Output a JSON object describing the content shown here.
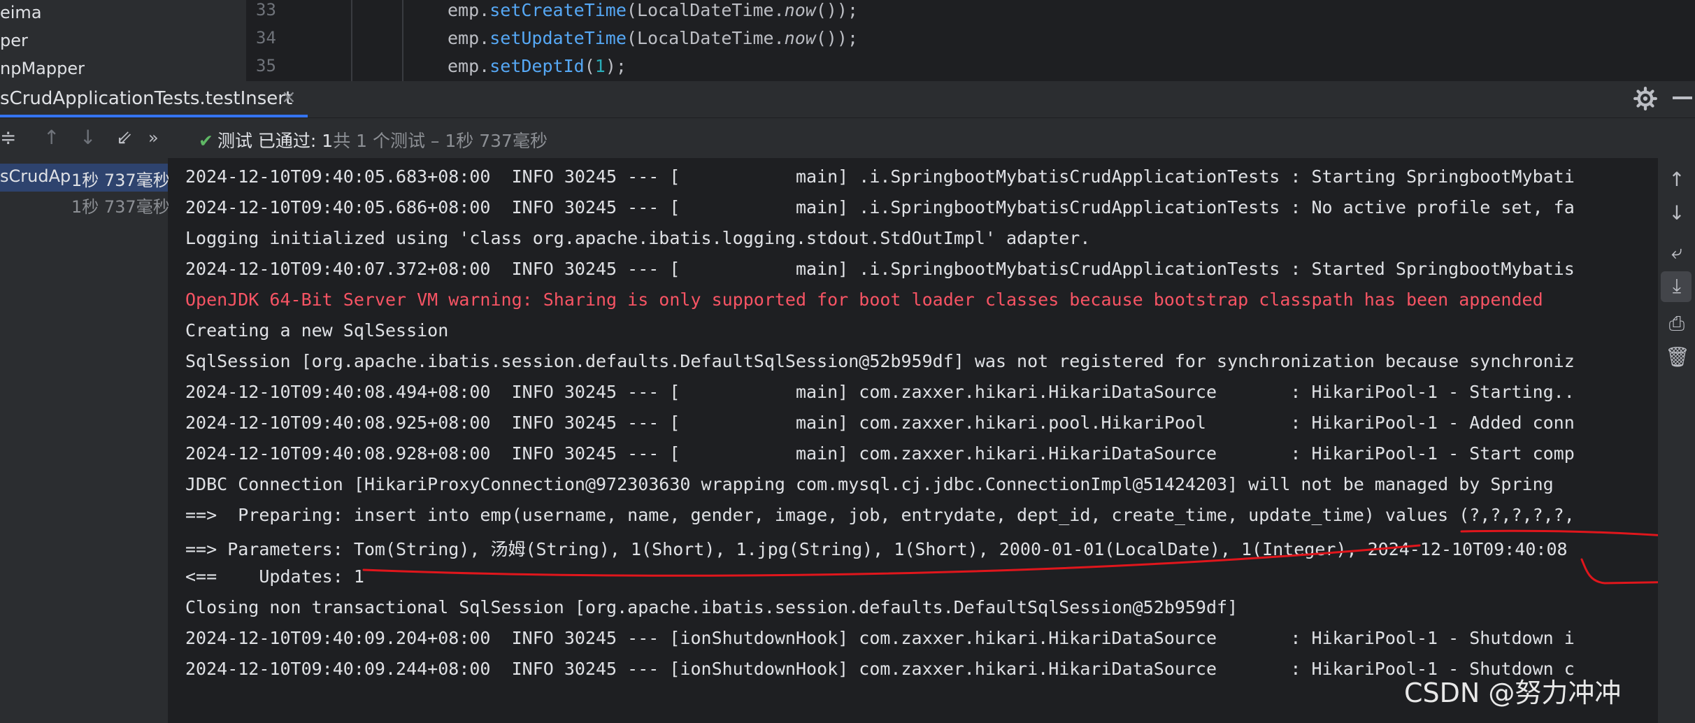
{
  "project": {
    "items": [
      "eima",
      "per",
      "npMapper"
    ]
  },
  "editor": {
    "line_numbers": [
      "33",
      "34",
      "35"
    ],
    "lines": [
      {
        "pre": "emp.",
        "method": "setCreateTime",
        "mid": "(LocalDateTime.",
        "call": "now",
        "post": "());"
      },
      {
        "pre": "emp.",
        "method": "setUpdateTime",
        "mid": "(LocalDateTime.",
        "call": "now",
        "post": "());"
      },
      {
        "pre": "emp.",
        "method": "setDeptId",
        "mid": "(",
        "call": "1",
        "post": ");"
      }
    ]
  },
  "run_tab": {
    "label": "sCrudApplicationTests.testInsert",
    "close": "×"
  },
  "toolbar": {
    "status_main": "测试 已通过: 1",
    "status_detail": "共 1 个测试 – 1秒 737毫秒"
  },
  "tree": {
    "root_name": "sCrudAp",
    "root_time": "1秒 737毫秒",
    "child_time": "1秒 737毫秒"
  },
  "console": {
    "lines": [
      {
        "text": "2024-12-10T09:40:05.683+08:00  INFO 30245 --- [           main] .i.SpringbootMybatisCrudApplicationTests : Starting SpringbootMybati",
        "warn": false
      },
      {
        "text": "2024-12-10T09:40:05.686+08:00  INFO 30245 --- [           main] .i.SpringbootMybatisCrudApplicationTests : No active profile set, fa",
        "warn": false
      },
      {
        "text": "Logging initialized using 'class org.apache.ibatis.logging.stdout.StdOutImpl' adapter.",
        "warn": false
      },
      {
        "text": "2024-12-10T09:40:07.372+08:00  INFO 30245 --- [           main] .i.SpringbootMybatisCrudApplicationTests : Started SpringbootMybatis",
        "warn": false
      },
      {
        "text": "OpenJDK 64-Bit Server VM warning: Sharing is only supported for boot loader classes because bootstrap classpath has been appended",
        "warn": true
      },
      {
        "text": "Creating a new SqlSession",
        "warn": false
      },
      {
        "text": "SqlSession [org.apache.ibatis.session.defaults.DefaultSqlSession@52b959df] was not registered for synchronization because synchroniz",
        "warn": false
      },
      {
        "text": "2024-12-10T09:40:08.494+08:00  INFO 30245 --- [           main] com.zaxxer.hikari.HikariDataSource       : HikariPool-1 - Starting..",
        "warn": false
      },
      {
        "text": "2024-12-10T09:40:08.925+08:00  INFO 30245 --- [           main] com.zaxxer.hikari.pool.HikariPool        : HikariPool-1 - Added conn",
        "warn": false
      },
      {
        "text": "2024-12-10T09:40:08.928+08:00  INFO 30245 --- [           main] com.zaxxer.hikari.HikariDataSource       : HikariPool-1 - Start comp",
        "warn": false
      },
      {
        "text": "JDBC Connection [HikariProxyConnection@972303630 wrapping com.mysql.cj.jdbc.ConnectionImpl@51424203] will not be managed by Spring",
        "warn": false
      },
      {
        "text": "==>  Preparing: insert into emp(username, name, gender, image, job, entrydate, dept_id, create_time, update_time) values (?,?,?,?,?,",
        "warn": false
      },
      {
        "text": "==> Parameters: Tom(String), 汤姆(String), 1(Short), 1.jpg(String), 1(Short), 2000-01-01(LocalDate), 1(Integer), 2024-12-10T09:40:08",
        "warn": false
      },
      {
        "text": "<==    Updates: 1",
        "warn": false
      },
      {
        "text": "Closing non transactional SqlSession [org.apache.ibatis.session.defaults.DefaultSqlSession@52b959df]",
        "warn": false
      },
      {
        "text": "2024-12-10T09:40:09.204+08:00  INFO 30245 --- [ionShutdownHook] com.zaxxer.hikari.HikariDataSource       : HikariPool-1 - Shutdown i",
        "warn": false
      },
      {
        "text": "2024-12-10T09:40:09.244+08:00  INFO 30245 --- [ionShutdownHook] com.zaxxer.hikari.HikariDataSource       : HikariPool-1 - Shutdown c",
        "warn": false
      }
    ]
  },
  "icons": {
    "collapse": "collapse-all-icon",
    "up": "arrow-up-icon",
    "down": "arrow-down-icon",
    "export": "export-icon",
    "more": "more-icon",
    "gear": "gear-icon",
    "scroll_up": "scroll-up-icon",
    "scroll_down": "scroll-down-icon",
    "soft_wrap": "soft-wrap-icon",
    "scroll_end": "scroll-to-end-icon",
    "print": "print-icon",
    "trash": "trash-icon"
  },
  "colors": {
    "accent": "#3574f0",
    "pass": "#5fb865",
    "warning": "#f75464",
    "annotation": "#e0161c"
  },
  "watermark": "CSDN @努力冲冲"
}
